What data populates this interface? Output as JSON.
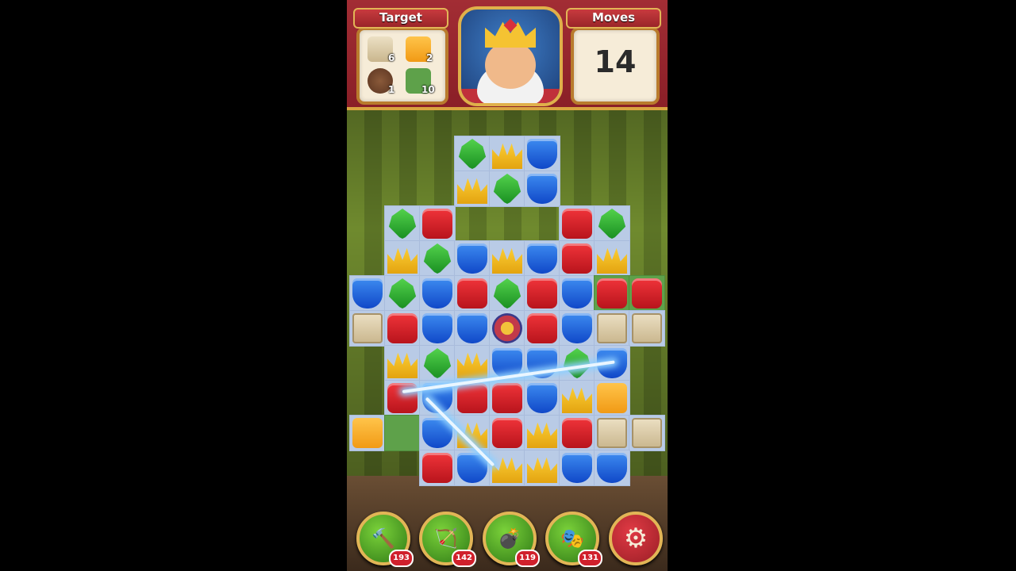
{
  "header": {
    "target_label": "Target",
    "moves_label": "Moves",
    "moves_value": "14",
    "targets": [
      {
        "name": "sack",
        "count": "6"
      },
      {
        "name": "orange-tile",
        "count": "2"
      },
      {
        "name": "pot",
        "count": "1"
      },
      {
        "name": "grass",
        "count": "10"
      }
    ]
  },
  "boosters": [
    {
      "name": "hammer-icon",
      "glyph": "🔨",
      "count": "193"
    },
    {
      "name": "arrow-icon",
      "glyph": "🏹",
      "count": "142"
    },
    {
      "name": "cannon-icon",
      "glyph": "💣",
      "count": "119"
    },
    {
      "name": "jester-hat-icon",
      "glyph": "🎭",
      "count": "131"
    }
  ],
  "settings_glyph": "⚙",
  "board": {
    "rows": [
      [
        null,
        null,
        null,
        "green",
        "yellow",
        "blue",
        null,
        null,
        null
      ],
      [
        null,
        null,
        null,
        "yellow",
        "green",
        "blue",
        null,
        null,
        null
      ],
      [
        null,
        "green",
        "red",
        null,
        null,
        null,
        "red",
        "green",
        null
      ],
      [
        null,
        "yellow",
        "green",
        "blue",
        "yellow",
        "blue",
        "red",
        "yellow",
        null
      ],
      [
        "blue",
        "green",
        "blue",
        "red",
        "green",
        "red",
        "blue",
        "red",
        "red"
      ],
      [
        "crate",
        "red",
        "blue",
        "blue",
        "jester",
        "red",
        "blue",
        "crate",
        "crate"
      ],
      [
        null,
        "yellow",
        "green",
        "yellow",
        "blue",
        "blue",
        "green",
        "blue",
        null
      ],
      [
        null,
        "red",
        "blue",
        "red",
        "red",
        "blue",
        "yellow",
        "orange",
        null
      ],
      [
        "orange",
        "grass",
        "blue",
        "yellow",
        "red",
        "yellow",
        "red",
        "crate",
        "crate"
      ],
      [
        null,
        null,
        "red",
        "blue",
        "yellow",
        "yellow",
        "blue",
        "blue",
        null
      ]
    ],
    "grass_cells": [
      "4-7",
      "4-8",
      "8-1"
    ]
  }
}
